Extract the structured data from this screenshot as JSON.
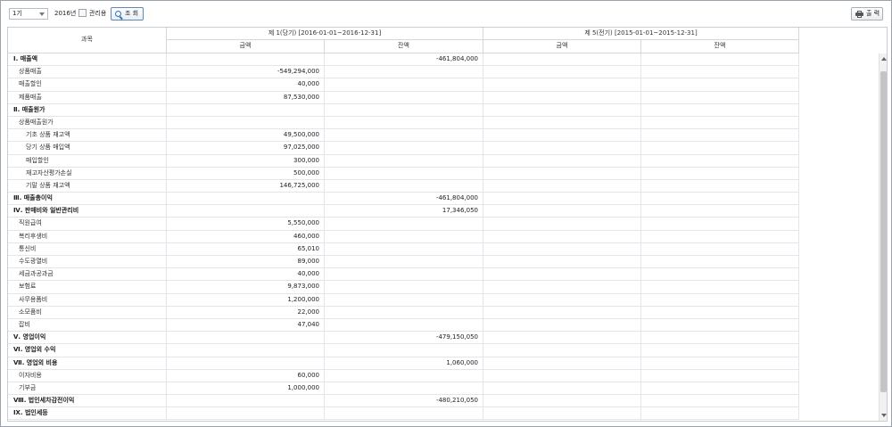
{
  "toolbar": {
    "period": "1기",
    "year": "2016년",
    "admin_label": "관리용",
    "search_label": "조 회",
    "print_label": "출 력"
  },
  "grid": {
    "header": {
      "subject": "과목",
      "current_period": "제 1(당기) [2016-01-01~2016-12-31]",
      "previous_period": "제 5(전기) [2015-01-01~2015-12-31]",
      "amount": "금액",
      "balance": "잔액"
    },
    "rows": [
      {
        "subject": "Ⅰ. 매출액",
        "amount": "",
        "balance": "-461,804,000",
        "prev_amount": "",
        "prev_balance": "",
        "level": 0
      },
      {
        "subject": "상품매출",
        "amount": "-549,294,000",
        "balance": "",
        "prev_amount": "",
        "prev_balance": "",
        "level": 1
      },
      {
        "subject": "매출할인",
        "amount": "40,000",
        "balance": "",
        "prev_amount": "",
        "prev_balance": "",
        "level": 1
      },
      {
        "subject": "제품매출",
        "amount": "87,530,000",
        "balance": "",
        "prev_amount": "",
        "prev_balance": "",
        "level": 1
      },
      {
        "subject": "Ⅱ. 매출원가",
        "amount": "",
        "balance": "",
        "prev_amount": "",
        "prev_balance": "",
        "level": 0
      },
      {
        "subject": "상품매출원가",
        "amount": "",
        "balance": "",
        "prev_amount": "",
        "prev_balance": "",
        "level": 1
      },
      {
        "subject": "기초 상품 재고액",
        "amount": "49,500,000",
        "balance": "",
        "prev_amount": "",
        "prev_balance": "",
        "level": 2
      },
      {
        "subject": "당기 상품 매입액",
        "amount": "97,025,000",
        "balance": "",
        "prev_amount": "",
        "prev_balance": "",
        "level": 2
      },
      {
        "subject": "매입할인",
        "amount": "300,000",
        "balance": "",
        "prev_amount": "",
        "prev_balance": "",
        "level": 2
      },
      {
        "subject": "재고자산평가손실",
        "amount": "500,000",
        "balance": "",
        "prev_amount": "",
        "prev_balance": "",
        "level": 2
      },
      {
        "subject": "기말 상품 재고액",
        "amount": "146,725,000",
        "balance": "",
        "prev_amount": "",
        "prev_balance": "",
        "level": 2
      },
      {
        "subject": "Ⅲ. 매출총이익",
        "amount": "",
        "balance": "-461,804,000",
        "prev_amount": "",
        "prev_balance": "",
        "level": 0
      },
      {
        "subject": "Ⅳ. 판매비와 일반관리비",
        "amount": "",
        "balance": "17,346,050",
        "prev_amount": "",
        "prev_balance": "",
        "level": 0
      },
      {
        "subject": "직원급여",
        "amount": "5,550,000",
        "balance": "",
        "prev_amount": "",
        "prev_balance": "",
        "level": 1
      },
      {
        "subject": "복리후생비",
        "amount": "460,000",
        "balance": "",
        "prev_amount": "",
        "prev_balance": "",
        "level": 1
      },
      {
        "subject": "통신비",
        "amount": "65,010",
        "balance": "",
        "prev_amount": "",
        "prev_balance": "",
        "level": 1
      },
      {
        "subject": "수도광열비",
        "amount": "89,000",
        "balance": "",
        "prev_amount": "",
        "prev_balance": "",
        "level": 1
      },
      {
        "subject": "세금과공과금",
        "amount": "40,000",
        "balance": "",
        "prev_amount": "",
        "prev_balance": "",
        "level": 1
      },
      {
        "subject": "보험료",
        "amount": "9,873,000",
        "balance": "",
        "prev_amount": "",
        "prev_balance": "",
        "level": 1
      },
      {
        "subject": "사무용품비",
        "amount": "1,200,000",
        "balance": "",
        "prev_amount": "",
        "prev_balance": "",
        "level": 1
      },
      {
        "subject": "소모품비",
        "amount": "22,000",
        "balance": "",
        "prev_amount": "",
        "prev_balance": "",
        "level": 1
      },
      {
        "subject": "잡비",
        "amount": "47,040",
        "balance": "",
        "prev_amount": "",
        "prev_balance": "",
        "level": 1
      },
      {
        "subject": "Ⅴ. 영업이익",
        "amount": "",
        "balance": "-479,150,050",
        "prev_amount": "",
        "prev_balance": "",
        "level": 0
      },
      {
        "subject": "Ⅵ. 영업외 수익",
        "amount": "",
        "balance": "",
        "prev_amount": "",
        "prev_balance": "",
        "level": 0
      },
      {
        "subject": "Ⅶ. 영업외 비용",
        "amount": "",
        "balance": "1,060,000",
        "prev_amount": "",
        "prev_balance": "",
        "level": 0
      },
      {
        "subject": "이자비용",
        "amount": "60,000",
        "balance": "",
        "prev_amount": "",
        "prev_balance": "",
        "level": 1
      },
      {
        "subject": "기부금",
        "amount": "1,000,000",
        "balance": "",
        "prev_amount": "",
        "prev_balance": "",
        "level": 1
      },
      {
        "subject": "Ⅷ. 법인세차감전이익",
        "amount": "",
        "balance": "-480,210,050",
        "prev_amount": "",
        "prev_balance": "",
        "level": 0
      },
      {
        "subject": "Ⅸ. 법인세등",
        "amount": "",
        "balance": "",
        "prev_amount": "",
        "prev_balance": "",
        "level": 0
      }
    ]
  },
  "icons": {
    "search": "search-icon",
    "print": "printer-icon",
    "dropdown": "chevron-down-icon",
    "scroll_up": "scroll-up-icon",
    "scroll_down": "scroll-down-icon"
  },
  "colors": {
    "border": "#c7cdd3",
    "search_accent": "#3a6fb0"
  }
}
